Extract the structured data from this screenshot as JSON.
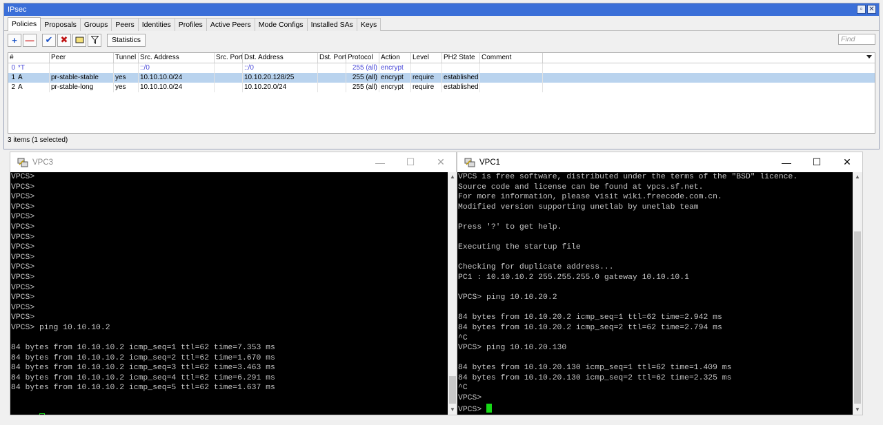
{
  "ipsec": {
    "title": "IPsec",
    "tabs": [
      "Policies",
      "Proposals",
      "Groups",
      "Peers",
      "Identities",
      "Profiles",
      "Active Peers",
      "Mode Configs",
      "Installed SAs",
      "Keys"
    ],
    "active_tab": "Policies",
    "toolbar": {
      "statistics_label": "Statistics",
      "find_placeholder": "Find"
    },
    "columns": [
      "#",
      "Peer",
      "Tunnel",
      "Src. Address",
      "Src. Port",
      "Dst. Address",
      "Dst. Port",
      "Protocol",
      "Action",
      "Level",
      "PH2 State",
      "Comment"
    ],
    "rows": [
      {
        "num": "0",
        "flags": "*T",
        "peer": "",
        "tunnel": "",
        "src_address": "::/0",
        "src_port": "",
        "dst_address": "::/0",
        "dst_port": "",
        "protocol": "255 (all)",
        "action": "encrypt",
        "level": "",
        "ph2_state": "",
        "comment": "",
        "dynamic": true,
        "selected": false
      },
      {
        "num": "1",
        "flags": "A",
        "peer": "pr-stable-stable",
        "tunnel": "yes",
        "src_address": "10.10.10.0/24",
        "src_port": "",
        "dst_address": "10.10.20.128/25",
        "dst_port": "",
        "protocol": "255 (all)",
        "action": "encrypt",
        "level": "require",
        "ph2_state": "established",
        "comment": "",
        "dynamic": false,
        "selected": true
      },
      {
        "num": "2",
        "flags": "A",
        "peer": "pr-stable-long",
        "tunnel": "yes",
        "src_address": "10.10.10.0/24",
        "src_port": "",
        "dst_address": "10.10.20.0/24",
        "dst_port": "",
        "protocol": "255 (all)",
        "action": "encrypt",
        "level": "require",
        "ph2_state": "established",
        "comment": "",
        "dynamic": false,
        "selected": false
      }
    ],
    "status": "3 items (1 selected)"
  },
  "vpc3": {
    "title": "VPC3",
    "lines": [
      "VPCS>",
      "VPCS>",
      "VPCS>",
      "VPCS>",
      "VPCS>",
      "VPCS>",
      "VPCS>",
      "VPCS>",
      "VPCS>",
      "VPCS>",
      "VPCS>",
      "VPCS>",
      "VPCS>",
      "VPCS>",
      "VPCS>",
      "VPCS> ping 10.10.10.2",
      "",
      "84 bytes from 10.10.10.2 icmp_seq=1 ttl=62 time=7.353 ms",
      "84 bytes from 10.10.10.2 icmp_seq=2 ttl=62 time=1.670 ms",
      "84 bytes from 10.10.10.2 icmp_seq=3 ttl=62 time=3.463 ms",
      "84 bytes from 10.10.10.2 icmp_seq=4 ttl=62 time=6.291 ms",
      "84 bytes from 10.10.10.2 icmp_seq=5 ttl=62 time=1.637 ms",
      "",
      ""
    ],
    "prompt": "VPCS> "
  },
  "vpc1": {
    "title": "VPC1",
    "lines": [
      "VPCS is free software, distributed under the terms of the \"BSD\" licence.",
      "Source code and license can be found at vpcs.sf.net.",
      "For more information, please visit wiki.freecode.com.cn.",
      "Modified version supporting unetlab by unetlab team",
      "",
      "Press '?' to get help.",
      "",
      "Executing the startup file",
      "",
      "Checking for duplicate address...",
      "PC1 : 10.10.10.2 255.255.255.0 gateway 10.10.10.1",
      "",
      "VPCS> ping 10.10.20.2",
      "",
      "84 bytes from 10.10.20.2 icmp_seq=1 ttl=62 time=2.942 ms",
      "84 bytes from 10.10.20.2 icmp_seq=2 ttl=62 time=2.794 ms",
      "^C",
      "VPCS> ping 10.10.20.130",
      "",
      "84 bytes from 10.10.20.130 icmp_seq=1 ttl=62 time=1.409 ms",
      "84 bytes from 10.10.20.130 icmp_seq=2 ttl=62 time=2.325 ms",
      "^C",
      "VPCS>"
    ],
    "prompt": "VPCS> "
  },
  "window_controls": {
    "minimize": "—",
    "maximize": "☐",
    "close": "✕"
  },
  "colors": {
    "titlebar": "#3b6fd8",
    "selected_row": "#b9d3ee",
    "cursor": "#16d916",
    "terminal_bg": "#000000",
    "terminal_fg": "#c6c6c6"
  }
}
